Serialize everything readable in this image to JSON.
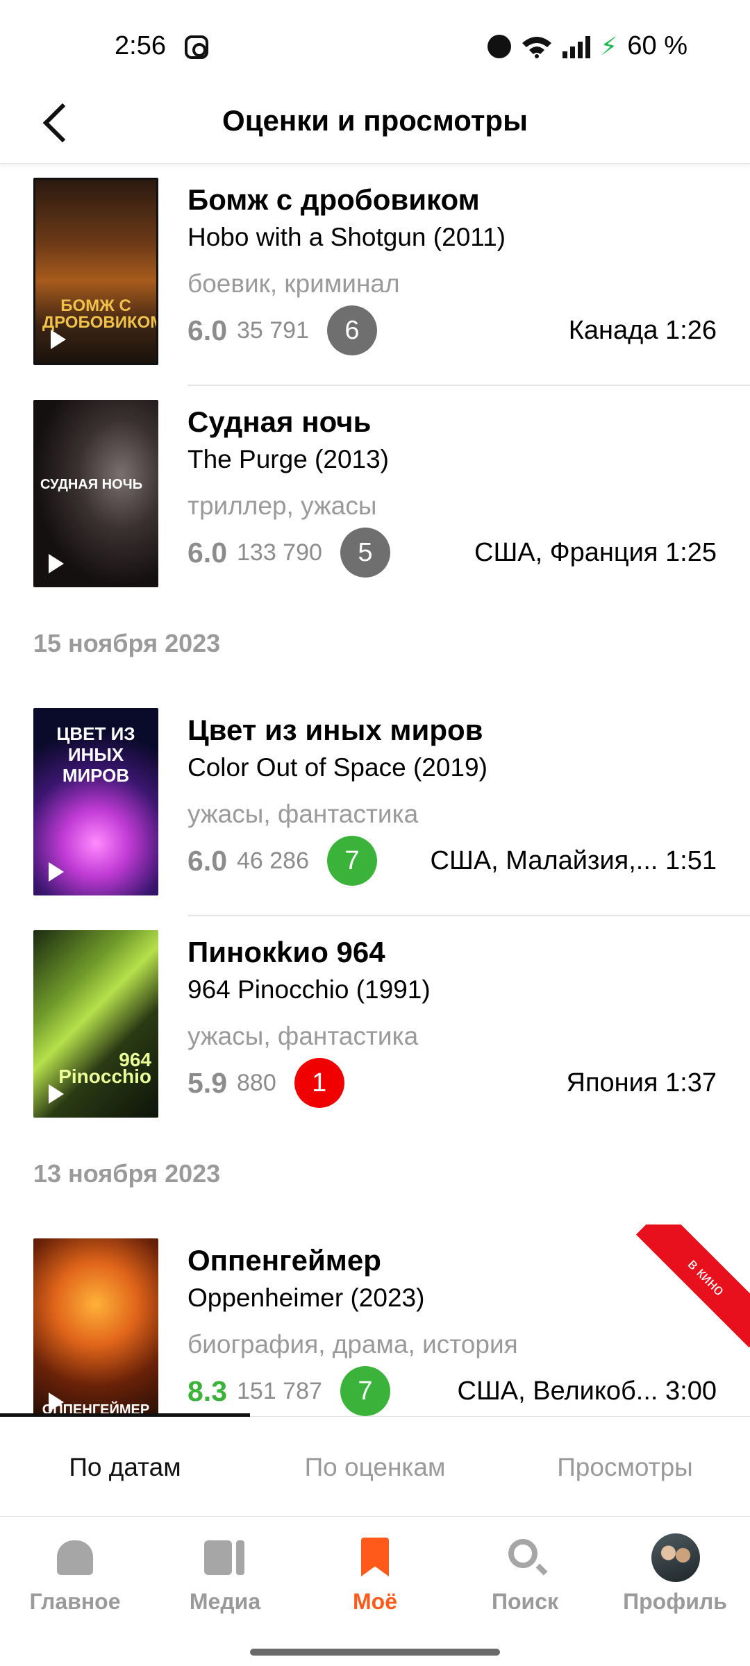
{
  "status_bar": {
    "time": "2:56",
    "battery": "60 %"
  },
  "header": {
    "title": "Оценки и просмотры"
  },
  "colors": {
    "accent": "#ff5a1a",
    "green": "#3bb33b",
    "red": "#f00000",
    "gray_badge": "#6f6f6f"
  },
  "list": {
    "groups": [
      {
        "date": "",
        "items": [
          {
            "title": "Бомж с дробовиком",
            "original": "Hobo with a Shotgun (2011)",
            "genres": "боевик, криминал",
            "rating": "6.0",
            "votes": "35 791",
            "my_score": "6",
            "my_score_color": "gray",
            "meta": "Канада 1:26",
            "poster_text": "БОМЖ С ДРОБОВИКОМ"
          },
          {
            "title": "Судная ночь",
            "original": "The Purge (2013)",
            "genres": "триллер, ужасы",
            "rating": "6.0",
            "votes": "133 790",
            "my_score": "5",
            "my_score_color": "gray",
            "meta": "США, Франция 1:25",
            "poster_text": "СУДНАЯ НОЧЬ"
          }
        ]
      },
      {
        "date": "15 ноября 2023",
        "items": [
          {
            "title": "Цвет из иных миров",
            "original": "Color Out of Space (2019)",
            "genres": "ужасы, фантастика",
            "rating": "6.0",
            "votes": "46 286",
            "my_score": "7",
            "my_score_color": "green",
            "meta": "США, Малайзия,... 1:51",
            "poster_text": "ЦВЕТ ИЗ ИНЫХ МИРОВ"
          },
          {
            "title": "Пинокkио 964",
            "original": "964 Pinocchio (1991)",
            "genres": "ужасы, фантастика",
            "rating": "5.9",
            "votes": "880",
            "my_score": "1",
            "my_score_color": "red",
            "meta": "Япония 1:37",
            "poster_text": "964 Pinocchio"
          }
        ]
      },
      {
        "date": "13 ноября 2023",
        "items": [
          {
            "title": "Оппенгеймер",
            "original": "Oppenheimer (2023)",
            "genres": "биография, драма, история",
            "rating": "8.3",
            "rating_color": "green",
            "votes": "151 787",
            "my_score": "7",
            "my_score_color": "green",
            "meta": "США, Великоб... 3:00",
            "ribbon": "в кино",
            "poster_text": "ОППЕНГЕЙМЕР"
          }
        ]
      }
    ]
  },
  "tabs": [
    {
      "label": "По датам",
      "active": true
    },
    {
      "label": "По оценкам",
      "active": false
    },
    {
      "label": "Просмотры",
      "active": false
    }
  ],
  "bottom_nav": [
    {
      "label": "Главное",
      "icon": "home-icon",
      "active": false
    },
    {
      "label": "Медиа",
      "icon": "media-icon",
      "active": false
    },
    {
      "label": "Моё",
      "icon": "bookmark-icon",
      "active": true
    },
    {
      "label": "Поиск",
      "icon": "search-icon",
      "active": false
    },
    {
      "label": "Профиль",
      "icon": "avatar",
      "active": false
    }
  ]
}
